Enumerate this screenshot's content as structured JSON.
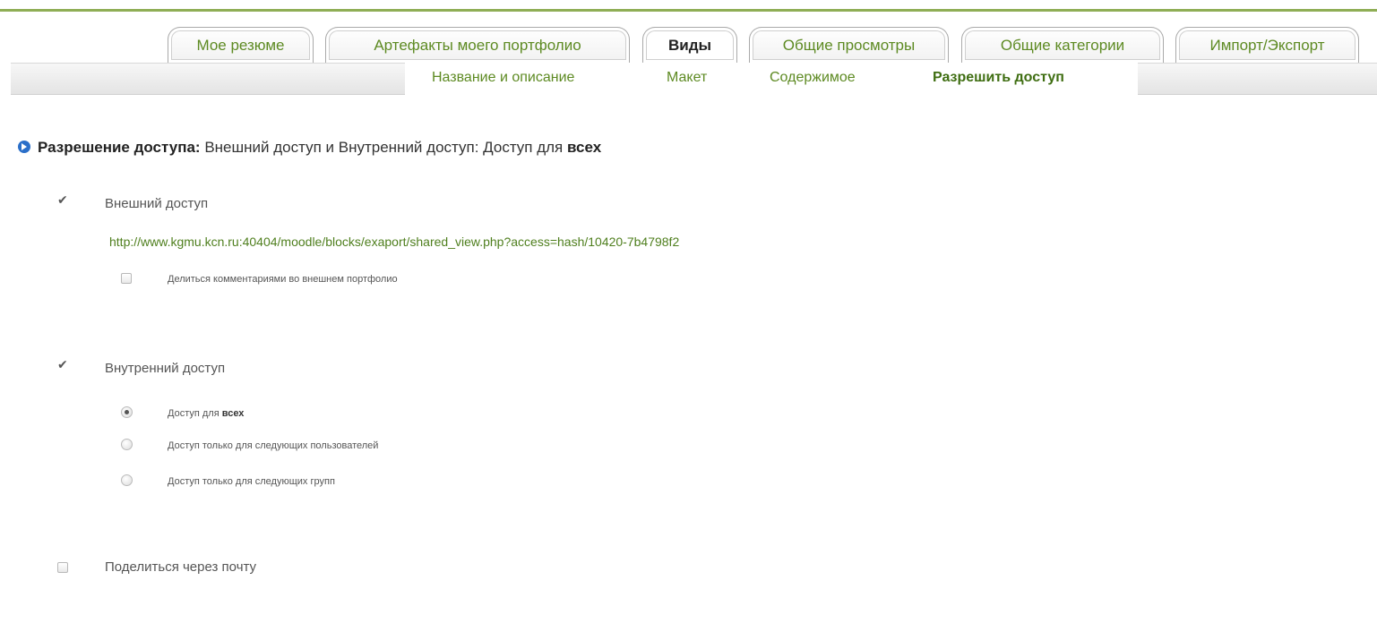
{
  "tabs": [
    {
      "label": "Мое резюме",
      "active": false
    },
    {
      "label": "Артефакты моего портфолио",
      "active": false
    },
    {
      "label": "Виды",
      "active": true
    },
    {
      "label": "Общие просмотры",
      "active": false
    },
    {
      "label": "Общие категории",
      "active": false
    },
    {
      "label": "Импорт/Экспорт",
      "active": false
    }
  ],
  "subnav": [
    {
      "label": "Название и описание",
      "active": false
    },
    {
      "label": "Макет",
      "active": false
    },
    {
      "label": "Содержимое",
      "active": false
    },
    {
      "label": "Разрешить доступ",
      "active": true
    }
  ],
  "heading": {
    "label": "Разрешение доступа:",
    "text": " Внешний доступ и Внутренний доступ: Доступ для ",
    "emph": "всех"
  },
  "external": {
    "label": "Внешний доступ",
    "checked": true,
    "url": "http://www.kgmu.kcn.ru:40404/moodle/blocks/exaport/shared_view.php?access=hash/10420-7b4798f2",
    "share_comments_label": "Делиться комментариями во внешнем портфолио",
    "share_comments_checked": false
  },
  "internal": {
    "label": "Внутренний доступ",
    "checked": true,
    "options": [
      {
        "prefix": "Доступ для ",
        "emph": "всех",
        "selected": true
      },
      {
        "prefix": "Доступ только для следующих пользователей",
        "emph": "",
        "selected": false
      },
      {
        "prefix": "Доступ только для следующих групп",
        "emph": "",
        "selected": false
      }
    ]
  },
  "email": {
    "label": "Поделиться через почту",
    "checked": false
  },
  "colors": {
    "accent_green": "#5d8a22",
    "bullet_blue": "#2a6fc9",
    "top_line": "#8fae55"
  }
}
